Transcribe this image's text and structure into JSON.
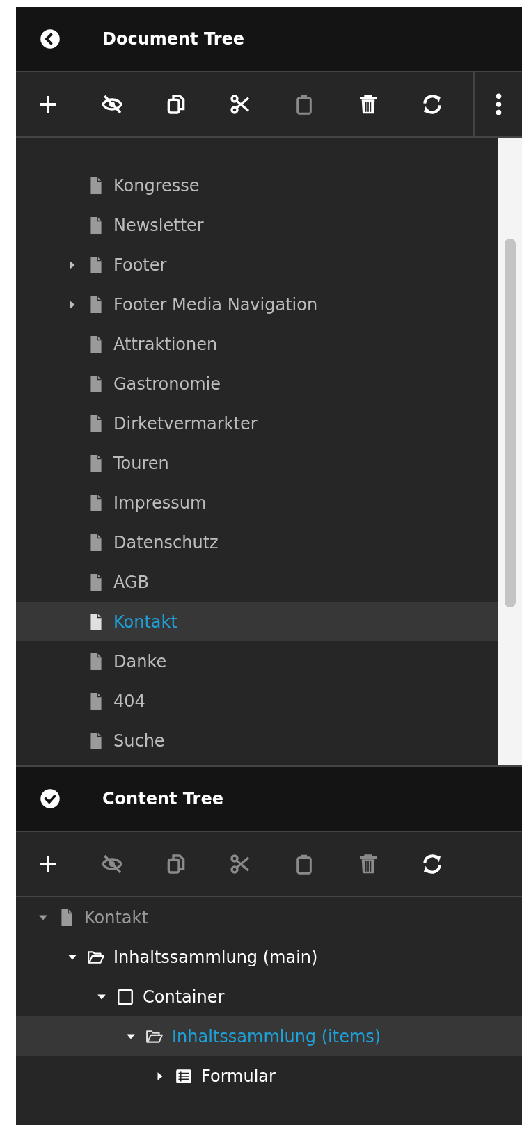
{
  "document_tree": {
    "title": "Document Tree",
    "toolbar": [
      {
        "disabled": false
      },
      {
        "disabled": false
      },
      {
        "disabled": false
      },
      {
        "disabled": false
      },
      {
        "disabled": true
      },
      {
        "disabled": false
      },
      {
        "disabled": false
      },
      {
        "disabled": false
      }
    ],
    "items": [
      {
        "label": "Kongresse",
        "has_children": false,
        "selected": false
      },
      {
        "label": "Newsletter",
        "has_children": false,
        "selected": false
      },
      {
        "label": "Footer",
        "has_children": true,
        "selected": false
      },
      {
        "label": "Footer Media Navigation",
        "has_children": true,
        "selected": false
      },
      {
        "label": "Attraktionen",
        "has_children": false,
        "selected": false
      },
      {
        "label": "Gastronomie",
        "has_children": false,
        "selected": false
      },
      {
        "label": "Dirketvermarkter",
        "has_children": false,
        "selected": false
      },
      {
        "label": "Touren",
        "has_children": false,
        "selected": false
      },
      {
        "label": "Impressum",
        "has_children": false,
        "selected": false
      },
      {
        "label": "Datenschutz",
        "has_children": false,
        "selected": false
      },
      {
        "label": "AGB",
        "has_children": false,
        "selected": false
      },
      {
        "label": "Kontakt",
        "has_children": false,
        "selected": true
      },
      {
        "label": "Danke",
        "has_children": false,
        "selected": false
      },
      {
        "label": "404",
        "has_children": false,
        "selected": false
      },
      {
        "label": "Suche",
        "has_children": false,
        "selected": false
      }
    ]
  },
  "content_tree": {
    "title": "Content Tree",
    "toolbar": [
      {
        "disabled": false
      },
      {
        "disabled": true
      },
      {
        "disabled": true
      },
      {
        "disabled": true
      },
      {
        "disabled": true
      },
      {
        "disabled": true
      },
      {
        "disabled": false
      }
    ],
    "items": [
      {
        "label": "Kontakt",
        "kind": "page",
        "has_children": true,
        "expanded": true,
        "selected": false,
        "muted": true,
        "children": [
          {
            "label": "Inhaltssammlung (main)",
            "kind": "folder",
            "has_children": true,
            "expanded": true,
            "selected": false,
            "muted": false,
            "children": [
              {
                "label": "Container",
                "kind": "container",
                "has_children": true,
                "expanded": true,
                "selected": false,
                "muted": false,
                "children": [
                  {
                    "label": "Inhaltssammlung (items)",
                    "kind": "folder",
                    "has_children": true,
                    "expanded": true,
                    "selected": true,
                    "muted": false,
                    "children": [
                      {
                        "label": "Formular",
                        "kind": "form",
                        "has_children": true,
                        "expanded": false,
                        "selected": false,
                        "muted": false
                      }
                    ]
                  }
                ]
              }
            ]
          }
        ]
      }
    ]
  }
}
